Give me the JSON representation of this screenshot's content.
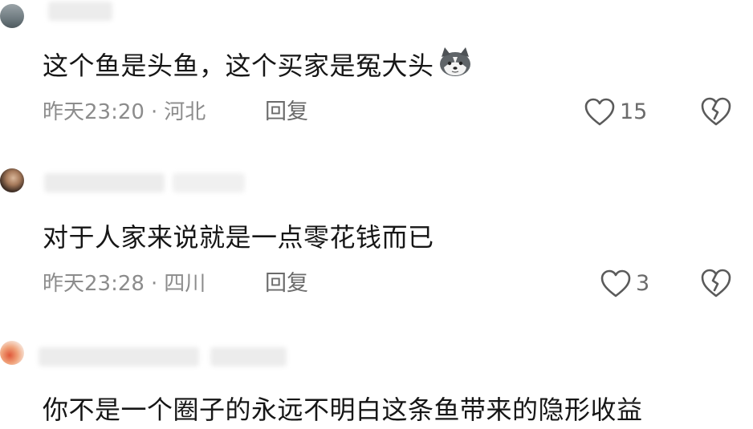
{
  "comments": [
    {
      "text": "这个鱼是头鱼，这个买家是冤大头",
      "emoji": "husky-emoji",
      "time": "昨天23:20",
      "separator": "·",
      "location": "河北",
      "reply_label": "回复",
      "like_count": "15"
    },
    {
      "text": "对于人家来说就是一点零花钱而已",
      "time": "昨天23:28",
      "separator": "·",
      "location": "四川",
      "reply_label": "回复",
      "like_count": "3"
    },
    {
      "text": "你不是一个圈子的永远不明白这条鱼带来的隐形收益"
    }
  ],
  "icons": {
    "like": "heart-outline-icon",
    "dislike": "broken-heart-icon"
  },
  "colors": {
    "meta_text": "#8c8c8c",
    "icon_stroke": "#5a5a5a"
  }
}
